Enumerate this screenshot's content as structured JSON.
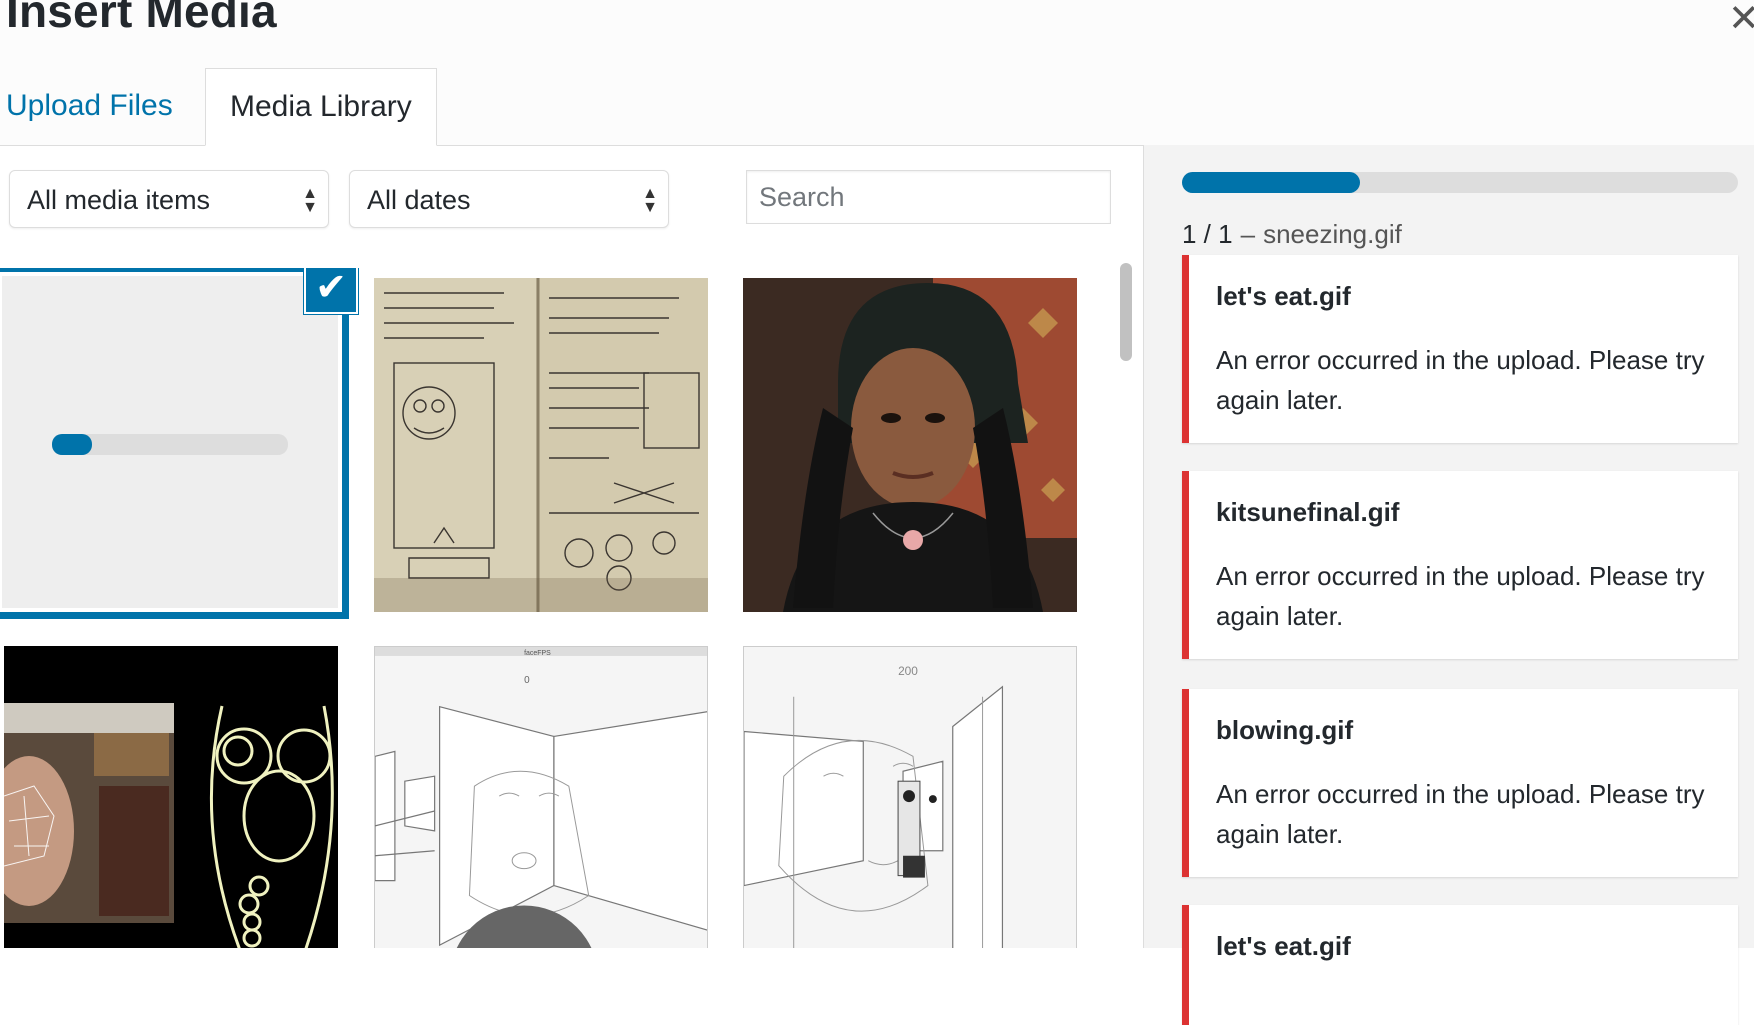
{
  "modal": {
    "title": "Insert Media",
    "close_icon": "close-icon"
  },
  "tabs": [
    {
      "label": "Upload Files",
      "active": false
    },
    {
      "label": "Media Library",
      "active": true
    }
  ],
  "filters": {
    "type_selected": "All media items",
    "date_selected": "All dates",
    "search_placeholder": "Search"
  },
  "grid": {
    "items": [
      {
        "kind": "uploading",
        "selected": true,
        "progress": 0.17
      },
      {
        "kind": "image",
        "desc": "notebook sketch"
      },
      {
        "kind": "image",
        "desc": "portrait photo"
      },
      {
        "kind": "image",
        "desc": "face tracking screenshot"
      },
      {
        "kind": "image",
        "desc": "faceFPS render",
        "caption_top": "faceFPS",
        "number": "0"
      },
      {
        "kind": "image",
        "desc": "3D render",
        "number": "200"
      }
    ]
  },
  "sidebar": {
    "progress": 0.32,
    "status_count": "1 / 1",
    "status_sep": "–",
    "status_file": "sneezing.gif",
    "errors": [
      {
        "file": "let's eat.gif",
        "message": "An error occurred in the upload. Please try again later."
      },
      {
        "file": "kitsunefinal.gif",
        "message": "An error occurred in the upload. Please try again later."
      },
      {
        "file": "blowing.gif",
        "message": "An error occurred in the upload. Please try again later."
      },
      {
        "file": "let's eat.gif",
        "message": ""
      }
    ]
  },
  "colors": {
    "accent": "#0073aa",
    "error": "#dc3232",
    "sidebar_bg": "#f3f3f3"
  }
}
